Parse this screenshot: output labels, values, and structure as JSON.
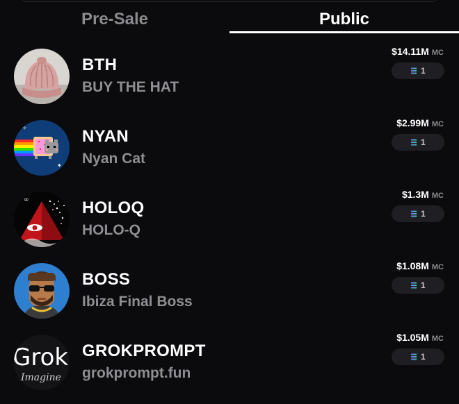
{
  "tabs": {
    "presale": "Pre-Sale",
    "public": "Public",
    "active": "Public"
  },
  "mc_label": "MC",
  "tokens": [
    {
      "ticker": "BTH",
      "name": "BUY THE HAT",
      "market_cap": "$14.11M",
      "chain_count": "1",
      "avatar_icon": "pink-knit-hat-image"
    },
    {
      "ticker": "NYAN",
      "name": "Nyan Cat",
      "market_cap": "$2.99M",
      "chain_count": "1",
      "avatar_icon": "nyan-cat-image"
    },
    {
      "ticker": "HOLOQ",
      "name": "HOLO-Q",
      "market_cap": "$1.3M",
      "chain_count": "1",
      "avatar_icon": "red-pyramid-eye-image"
    },
    {
      "ticker": "BOSS",
      "name": "Ibiza Final Boss",
      "market_cap": "$1.08M",
      "chain_count": "1",
      "avatar_icon": "bearded-man-sunglasses-image"
    },
    {
      "ticker": "GROKPROMPT",
      "name": "grokprompt.fun",
      "market_cap": "$1.05M",
      "chain_count": "1",
      "avatar_icon": "grok-imagine-logo"
    }
  ],
  "avatar_text": {
    "grok": "Grok",
    "imagine": "Imagine"
  },
  "colors": {
    "background": "#0b0b0d",
    "chip": "#1f1f23",
    "muted_text": "#8e8e93",
    "solana_gradient": [
      "#9945FF",
      "#14F195"
    ]
  }
}
